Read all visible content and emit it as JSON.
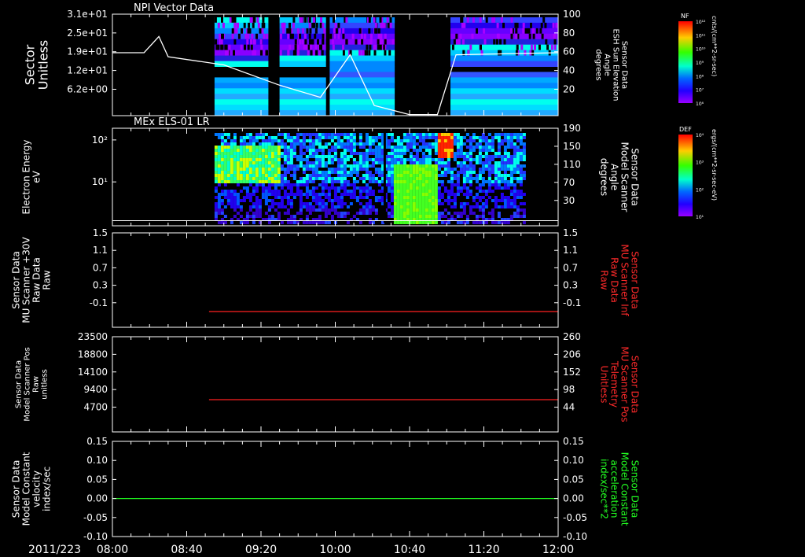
{
  "header": {
    "date": "2011/223"
  },
  "time_axis": {
    "labels": [
      "08:00",
      "08:40",
      "09:20",
      "10:00",
      "10:40",
      "11:20",
      "12:00"
    ]
  },
  "colors": {
    "frame": "#ffffff",
    "red_trace": "#ff2020",
    "green_trace": "#20ff20",
    "red_label": "#ff2a2a",
    "green_label": "#22ff22"
  },
  "panels": [
    {
      "id": "npi",
      "title": "NPI Vector Data",
      "left_label": [
        "Sector",
        "Unitless"
      ],
      "right_label": [
        "Sensor Data",
        "ESH Sun Elevation",
        "Angle",
        "degrees"
      ],
      "left_ticks": [
        "3.1e+01",
        "2.5e+01",
        "1.9e+01",
        "1.2e+01",
        "6.2e+00"
      ],
      "right_ticks": [
        "100",
        "80",
        "60",
        "40",
        "20"
      ]
    },
    {
      "id": "els",
      "title": "MEx ELS-01 LR",
      "left_label": [
        "Electron Energy",
        "eV"
      ],
      "right_label": [
        "Sensor Data",
        "Model Scanner",
        "Angle",
        "degrees"
      ],
      "left_ticks": [
        "10²",
        "10¹"
      ],
      "right_ticks": [
        "190",
        "150",
        "110",
        "70",
        "30"
      ]
    },
    {
      "id": "mu-raw",
      "left_label": [
        "Sensor Data",
        "MU Scanner +30V",
        "Raw Data",
        "Raw"
      ],
      "right_label": [
        "Sensor Data",
        "MU Scanner Inf",
        "Raw Data",
        "Raw"
      ],
      "left_ticks": [
        "1.5",
        "1.1",
        "0.7",
        "0.3",
        "-0.1"
      ],
      "right_ticks": [
        "1.5",
        "1.1",
        "0.7",
        "0.3",
        "-0.1"
      ]
    },
    {
      "id": "mu-pos",
      "left_label": [
        "Sensor Data",
        "Model Scanner Pos",
        "Raw",
        "unitless"
      ],
      "right_label": [
        "Sensor Data",
        "MU Scanner Pos",
        "Telemetry",
        "Unitless"
      ],
      "left_ticks": [
        "23500",
        "18800",
        "14100",
        "9400",
        "4700"
      ],
      "right_ticks": [
        "260",
        "206",
        "152",
        "98",
        "44"
      ]
    },
    {
      "id": "model",
      "left_label": [
        "Sensor Data",
        "Model Constant",
        "velocity",
        "index/sec"
      ],
      "right_label": [
        "Sensor Data",
        "Model Constant",
        "acceleration",
        "index/sec**2"
      ],
      "left_ticks": [
        "0.15",
        "0.10",
        "0.05",
        "0.00",
        "-0.05",
        "-0.10"
      ],
      "right_ticks": [
        "0.15",
        "0.10",
        "0.05",
        "0.00",
        "-0.05",
        "-0.10"
      ]
    }
  ],
  "colorbars": [
    {
      "title": "NF",
      "units": "cnts/(cm**2-sr-sec)",
      "ticks": [
        "10¹²",
        "10¹¹",
        "10¹⁰",
        "10⁹",
        "10⁸",
        "10⁷",
        "10⁶"
      ]
    },
    {
      "title": "DEF",
      "units": "ergs/(cm**2-sr-sec-eV)",
      "ticks": [
        "10⁴",
        "10³",
        "10²",
        "10¹"
      ]
    }
  ],
  "chart_data": [
    {
      "type": "heatmap",
      "title": "NPI Vector Data",
      "ylabel": "Sector Unitless",
      "yticks": [
        31,
        25,
        19,
        12,
        6.2
      ],
      "x_range": [
        "08:00",
        "12:00"
      ],
      "data_segments": [
        [
          "08:55",
          "09:24"
        ],
        [
          "09:30",
          "09:55"
        ],
        [
          "09:57",
          "10:32"
        ],
        [
          "11:02",
          "12:00"
        ]
      ],
      "overlay_line": {
        "name": "ESH Sun Elevation Angle",
        "unit": "degrees",
        "y_range": [
          0,
          100
        ],
        "x": [
          "08:00",
          "08:17",
          "08:25",
          "08:30",
          "09:00",
          "09:30",
          "09:52",
          "10:08",
          "10:21",
          "10:40",
          "10:55",
          "11:05",
          "12:00"
        ],
        "y": [
          62,
          62,
          78,
          58,
          50,
          30,
          18,
          60,
          10,
          1,
          1,
          60,
          62
        ]
      }
    },
    {
      "type": "heatmap",
      "title": "MEx ELS-01 LR",
      "ylabel": "Electron Energy eV",
      "yscale": "log",
      "x_range": [
        "08:00",
        "12:00"
      ],
      "data_range": [
        "08:55",
        "11:42"
      ],
      "overlay_line": {
        "name": "Model Scanner Angle",
        "unit": "degrees",
        "y_range": [
          0,
          190
        ],
        "x": [
          "08:00",
          "12:00"
        ],
        "y": [
          10,
          10
        ]
      }
    },
    {
      "type": "line",
      "ylabel": "MU Scanner +30V Raw",
      "y_range": [
        -0.3,
        1.5
      ],
      "series": [
        {
          "name": "MU Scanner Inf Raw Data",
          "x": [
            "08:52",
            "12:00"
          ],
          "y": [
            0.0,
            0.0
          ]
        }
      ]
    },
    {
      "type": "line",
      "ylabel": "Model Scanner Pos Raw unitless",
      "y_range": [
        0,
        23500
      ],
      "series": [
        {
          "name": "MU Scanner Pos Telemetry",
          "x": [
            "08:52",
            "12:00"
          ],
          "y": [
            98,
            98
          ]
        }
      ]
    },
    {
      "type": "line",
      "ylabel": "Model Constant velocity index/sec",
      "y_range": [
        -0.1,
        0.15
      ],
      "series": [
        {
          "name": "Model Constant acceleration index/sec**2",
          "x": [
            "08:00",
            "12:00"
          ],
          "y": [
            0.0,
            0.0
          ]
        }
      ]
    }
  ]
}
